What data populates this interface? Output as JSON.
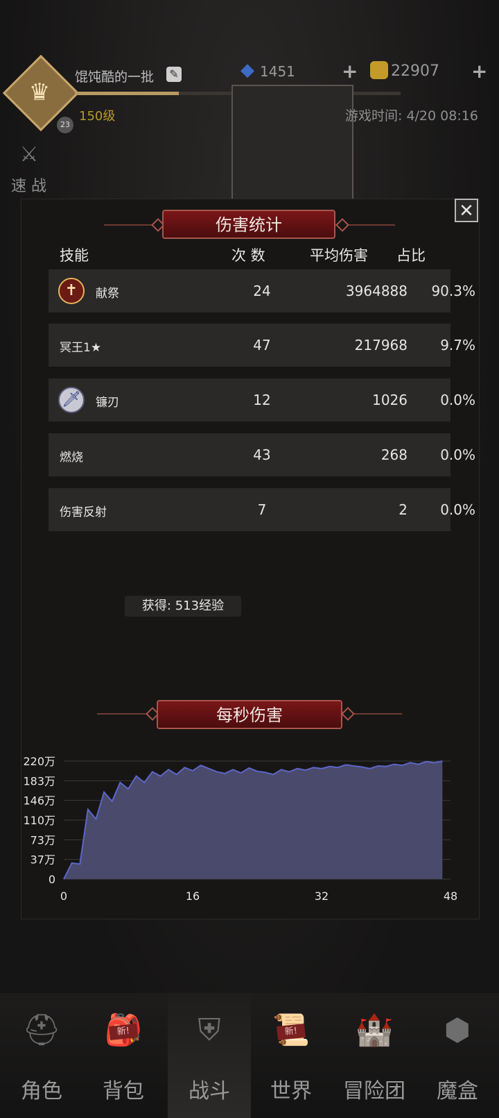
{
  "header": {
    "player_name": "馄饨酷的一批",
    "level": "150级",
    "rank": "23",
    "gems": "1451",
    "gold": "22907",
    "game_time": "游戏时间: 4/20 08:16",
    "speed_battle": "速 战"
  },
  "modal": {
    "title": "伤害统计",
    "close": "✕",
    "columns": {
      "skill": "技能",
      "count": "次 数",
      "avg": "平均伤害",
      "share": "占比"
    },
    "rows": [
      {
        "name": "献祭",
        "count": "24",
        "avg": "3964888",
        "share": "90.3%",
        "icon": "sacrifice-icon"
      },
      {
        "name": "冥王1★",
        "count": "47",
        "avg": "217968",
        "share": "9.7%",
        "icon": ""
      },
      {
        "name": "镰刃",
        "count": "12",
        "avg": "1026",
        "share": "0.0%",
        "icon": "sword-icon"
      },
      {
        "name": "燃烧",
        "count": "43",
        "avg": "268",
        "share": "0.0%",
        "icon": ""
      },
      {
        "name": "伤害反射",
        "count": "7",
        "avg": "2",
        "share": "0.0%",
        "icon": ""
      }
    ],
    "exp_gain": "获得: 513经验",
    "dps_title": "每秒伤害"
  },
  "chart_data": {
    "type": "area",
    "title": "每秒伤害",
    "x_ticks": [
      "0",
      "16",
      "32",
      "48"
    ],
    "y_ticks": [
      "0",
      "37万",
      "73万",
      "110万",
      "146万",
      "183万",
      "220万"
    ],
    "xlim": [
      0,
      48
    ],
    "ylim": [
      0,
      2200000
    ],
    "grid": true,
    "series": [
      {
        "x": [
          0,
          1,
          2,
          3,
          4,
          5,
          6,
          7,
          8,
          9,
          10,
          11,
          12,
          13,
          14,
          15,
          16,
          17,
          18,
          19,
          20,
          21,
          22,
          23,
          24,
          25,
          26,
          27,
          28,
          29,
          30,
          31,
          32,
          33,
          34,
          35,
          36,
          37,
          38,
          39,
          40,
          41,
          42,
          43,
          44,
          45,
          46,
          47
        ],
        "values": [
          0,
          300000,
          280000,
          1300000,
          1120000,
          1620000,
          1450000,
          1800000,
          1680000,
          1920000,
          1800000,
          2000000,
          1920000,
          2040000,
          1950000,
          2080000,
          2020000,
          2120000,
          2060000,
          2000000,
          1970000,
          2040000,
          1980000,
          2070000,
          2010000,
          1990000,
          1950000,
          2040000,
          2000000,
          2060000,
          2030000,
          2080000,
          2060000,
          2100000,
          2080000,
          2130000,
          2110000,
          2090000,
          2060000,
          2110000,
          2100000,
          2140000,
          2120000,
          2170000,
          2140000,
          2190000,
          2170000,
          2200000
        ]
      }
    ],
    "color": "#4a4a6c",
    "line_color": "#5d66c9"
  },
  "nav": {
    "items": [
      {
        "label": "角色",
        "icon": "helmet-icon"
      },
      {
        "label": "背包",
        "icon": "backpack-icon",
        "badge": "新!"
      },
      {
        "label": "战斗",
        "icon": "shield-sword-icon",
        "active": true
      },
      {
        "label": "世界",
        "icon": "map-scroll-icon",
        "badge": "新!"
      },
      {
        "label": "冒险团",
        "icon": "castle-icon"
      },
      {
        "label": "魔盒",
        "icon": "cube-icon"
      }
    ]
  },
  "colors": {
    "accent_red": "#7a1618",
    "gold": "#b69b2d",
    "row_bg": "#2a2928"
  }
}
